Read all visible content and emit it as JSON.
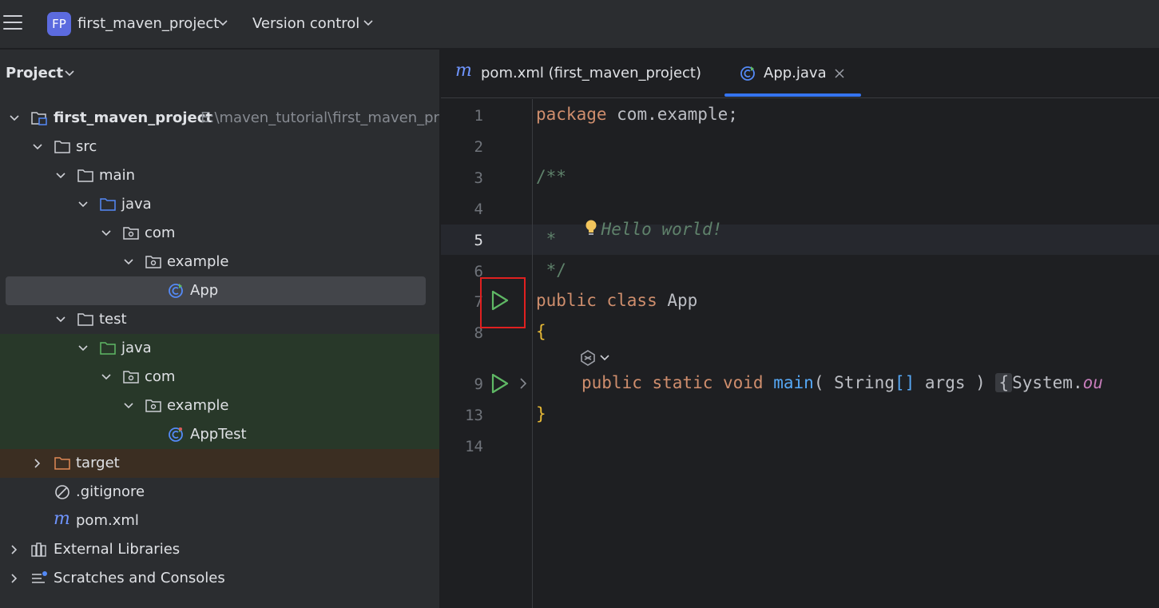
{
  "titlebar": {
    "menu_icon": "hamburger-menu-icon",
    "project_badge": "FP",
    "project_name": "first_maven_project",
    "vcs_label": "Version control"
  },
  "sidebar": {
    "title": "Project",
    "tree": [
      {
        "label": "first_maven_project",
        "path": "E:\\maven_tutorial\\first_maven_proje",
        "icon": "module-folder-icon",
        "expanded": true
      },
      {
        "label": "src",
        "icon": "folder-icon",
        "expanded": true
      },
      {
        "label": "main",
        "icon": "folder-icon",
        "expanded": true
      },
      {
        "label": "java",
        "icon": "source-root-folder-icon",
        "expanded": true
      },
      {
        "label": "com",
        "icon": "package-icon",
        "expanded": true
      },
      {
        "label": "example",
        "icon": "package-icon",
        "expanded": true
      },
      {
        "label": "App",
        "icon": "java-class-icon",
        "selected": true
      },
      {
        "label": "test",
        "icon": "folder-icon",
        "expanded": true
      },
      {
        "label": "java",
        "icon": "test-root-folder-icon",
        "expanded": true
      },
      {
        "label": "com",
        "icon": "package-icon",
        "expanded": true
      },
      {
        "label": "example",
        "icon": "package-icon",
        "expanded": true
      },
      {
        "label": "AppTest",
        "icon": "java-test-class-icon"
      },
      {
        "label": "target",
        "icon": "excluded-folder-icon",
        "expanded": false
      },
      {
        "label": ".gitignore",
        "icon": "ignored-file-icon"
      },
      {
        "label": "pom.xml",
        "icon": "maven-icon"
      },
      {
        "label": "External Libraries",
        "icon": "libraries-icon",
        "expanded": false
      },
      {
        "label": "Scratches and Consoles",
        "icon": "scratches-icon",
        "expanded": false
      }
    ]
  },
  "editor": {
    "tabs": [
      {
        "label": "pom.xml (first_maven_project)",
        "icon": "maven-icon",
        "active": false
      },
      {
        "label": "App.java",
        "icon": "java-class-icon",
        "active": true,
        "close_icon": "close-icon"
      }
    ],
    "line_numbers": [
      "1",
      "2",
      "3",
      "4",
      "5",
      "6",
      "7",
      "8",
      "9",
      "13",
      "14"
    ],
    "current_line": "5",
    "code": {
      "l1_kw": "package",
      "l1_rest": " com.example;",
      "l3": "/**",
      "l4": "Hello world!",
      "l5": " *",
      "l6": " */",
      "l7_kw": "public class",
      "l7_rest": " App",
      "l8": "{",
      "l9_kw": "public static void",
      "l9_fn": "main",
      "l9_open": "( String",
      "l9_arr": "[]",
      "l9_args": " args )",
      "l9_brace": "{",
      "l9_sys": "System.",
      "l9_out": "ou",
      "l13": "}"
    }
  },
  "colors": {
    "accent": "#3574f0",
    "run_green": "#5fb865",
    "highlight_red": "#e02020"
  }
}
